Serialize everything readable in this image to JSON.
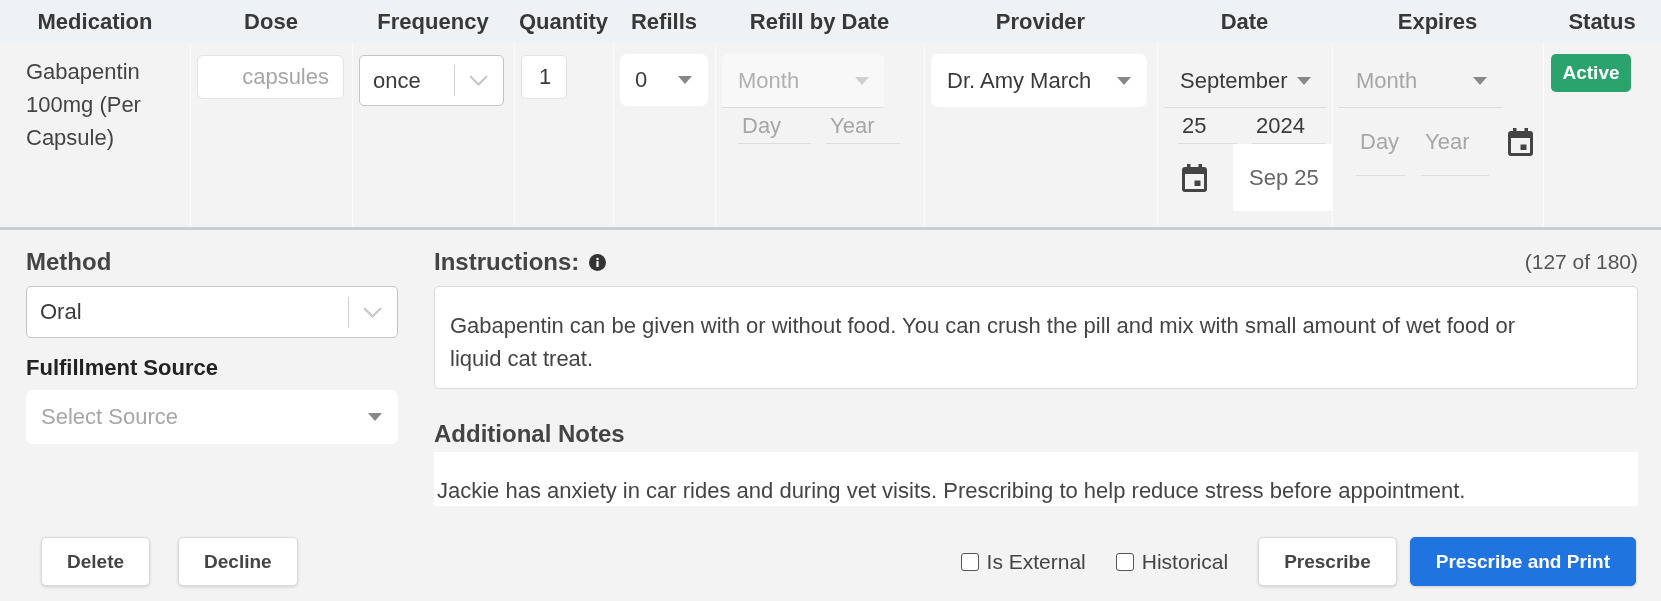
{
  "table": {
    "columns": [
      "Medication",
      "Dose",
      "Frequency",
      "Quantity",
      "Refills",
      "Refill by Date",
      "Provider",
      "Date",
      "Expires",
      "Status"
    ],
    "rows": [
      {
        "medication": "Gabapentin 100mg (Per Capsule)",
        "dose": {
          "placeholder": "capsules"
        },
        "frequency": {
          "value": "once"
        },
        "quantity": {
          "value": "1"
        },
        "refills": {
          "value": "0"
        },
        "refill_by_date": {
          "month": {
            "placeholder": "Month",
            "disabled": true
          },
          "day": {
            "placeholder": "Day"
          },
          "year": {
            "placeholder": "Year"
          }
        },
        "provider": {
          "value": "Dr. Amy March"
        },
        "date": {
          "month": {
            "value": "September",
            "disabled": false
          },
          "day": {
            "value": "25"
          },
          "year": {
            "value": "2024"
          },
          "preview": "Sep 25"
        },
        "expires": {
          "month": {
            "placeholder": "Month",
            "disabled": false
          },
          "day": {
            "placeholder": "Day"
          },
          "year": {
            "placeholder": "Year"
          }
        },
        "status": {
          "label": "Active"
        }
      }
    ]
  },
  "method": {
    "label": "Method",
    "value": "Oral"
  },
  "fulfillment_source": {
    "label": "Fulfillment Source",
    "placeholder": "Select Source"
  },
  "instructions": {
    "label": "Instructions:",
    "counter": "(127 of 180)",
    "value": "Gabapentin can be given with or without food. You can crush the pill and mix with small amount of wet food or liquid cat treat."
  },
  "additional_notes": {
    "label": "Additional Notes",
    "value": "Jackie has anxiety in car rides and during vet visits. Prescribing to help reduce stress before appointment."
  },
  "options": [
    {
      "label": "Is External",
      "checked": false
    },
    {
      "label": "Historical",
      "checked": false
    }
  ],
  "left_buttons": [
    {
      "label": "Delete",
      "kind": "default"
    },
    {
      "label": "Decline",
      "kind": "default"
    }
  ],
  "right_buttons": [
    {
      "label": "Prescribe",
      "kind": "default"
    },
    {
      "label": "Prescribe and Print",
      "kind": "primary"
    }
  ]
}
